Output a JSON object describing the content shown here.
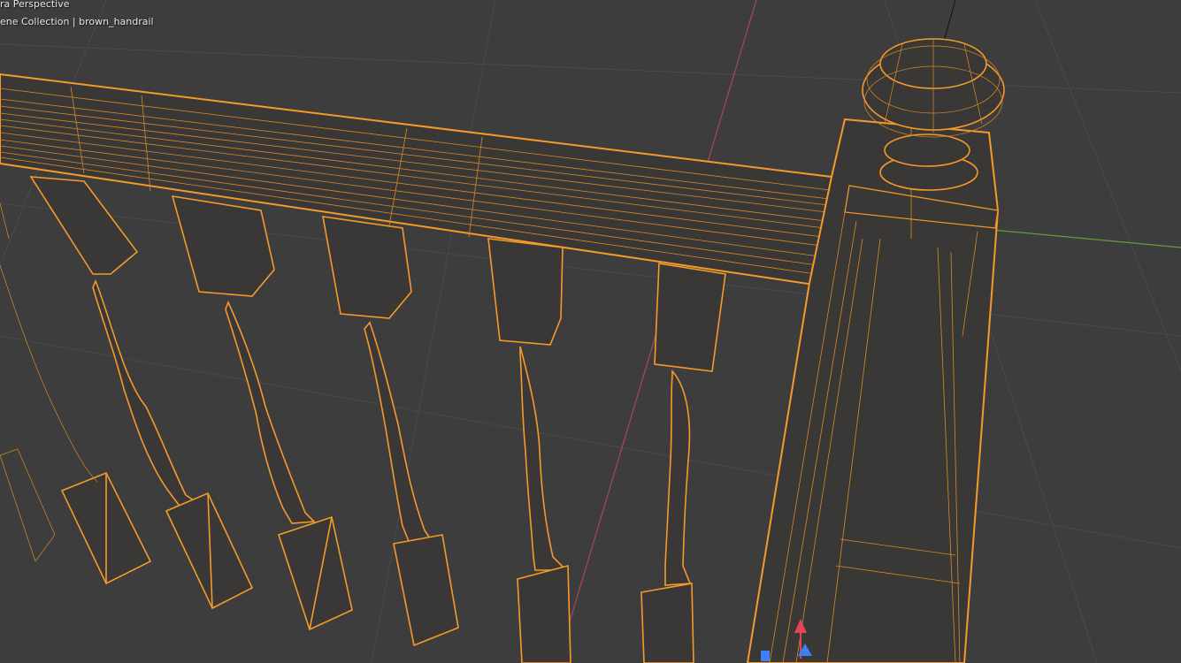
{
  "viewport": {
    "view_name": "ra Perspective",
    "collection_label": "ene Collection | brown_handrail"
  },
  "object": {
    "name": "brown_handrail",
    "selection_color": "#f59a2a"
  },
  "colors": {
    "background": "#3d3d3d",
    "grid": "#4a4a4a",
    "x_axis": "#a84a55",
    "y_axis": "#6a9a3a",
    "wire": "#f59a2a",
    "wire_dense": "#d98825",
    "body": "#3a3836"
  },
  "gizmo": {
    "icons": [
      "arrow-up-icon",
      "arrow-blue-icon"
    ]
  }
}
